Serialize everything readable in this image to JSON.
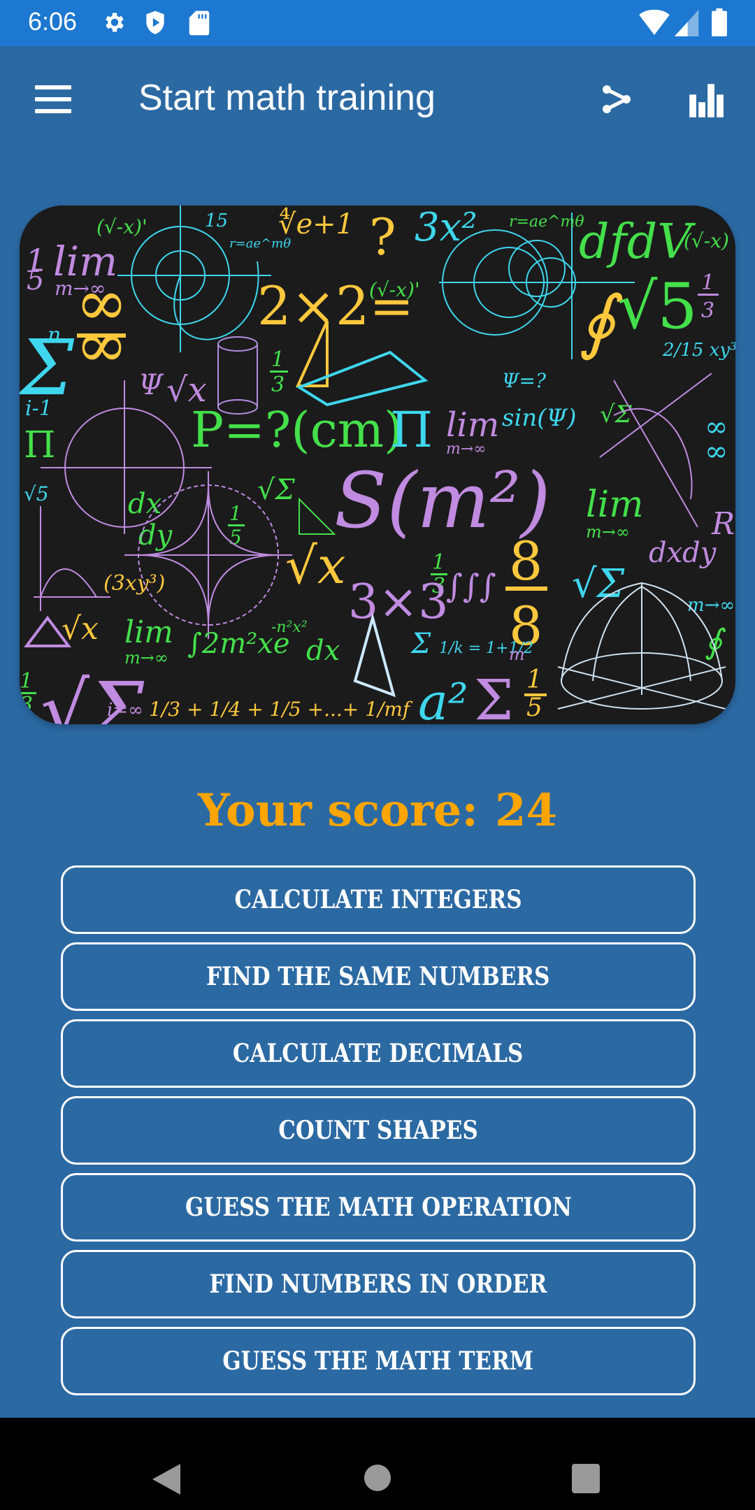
{
  "status_bar": {
    "time": "6:06",
    "left_icons": [
      "settings-icon",
      "play-protect-icon",
      "sd-card-icon"
    ],
    "right_icons": [
      "wifi-icon",
      "cellular-signal-icon",
      "battery-icon"
    ]
  },
  "app_bar": {
    "title": "Start math training",
    "menu_icon": "hamburger-menu-icon",
    "actions": [
      {
        "icon": "share-icon",
        "name": "share"
      },
      {
        "icon": "bar-chart-icon",
        "name": "statistics"
      }
    ]
  },
  "hero_image": {
    "description": "Chalkboard with colorful handwritten math formulas",
    "formulas": [
      "lim m→∞",
      "2×2=?",
      "3x²",
      "r=ae^mθ",
      "∜(e+1)",
      "dfdV",
      "(√-x)'",
      "∞/∞",
      "Σ i=1..n",
      "Ψ",
      "√x",
      "1/3",
      "P=?(cm)",
      "π",
      "sin(Ψ)",
      "∮√5",
      "1/3",
      "2/15 xy³",
      "S(m²)",
      "dx",
      "dy",
      "(3xy³)",
      "√Σ",
      "3×3",
      "8/8",
      "dx dy",
      "m→∞",
      "lim ∫2m²xe^(-n²x²)dx",
      "Σ 1/k = 1+1/2",
      "a²Σ",
      "1/5",
      "1/3+1/4+1/5+...+1/mf",
      "i=∞"
    ]
  },
  "score": {
    "label": "Your score:",
    "value": "24"
  },
  "colors": {
    "background": "#2B69A3",
    "status_bar": "#1C78D0",
    "score": "#FFA500",
    "button_border": "#FFFFFF"
  },
  "menu_buttons": [
    {
      "label": "CALCULATE INTEGERS"
    },
    {
      "label": "FIND THE SAME NUMBERS"
    },
    {
      "label": "CALCULATE DECIMALS"
    },
    {
      "label": "COUNT SHAPES"
    },
    {
      "label": "GUESS THE MATH OPERATION"
    },
    {
      "label": "FIND NUMBERS IN ORDER"
    },
    {
      "label": "GUESS THE MATH TERM"
    }
  ],
  "nav_bar": {
    "buttons": [
      "back",
      "home",
      "recents"
    ]
  }
}
